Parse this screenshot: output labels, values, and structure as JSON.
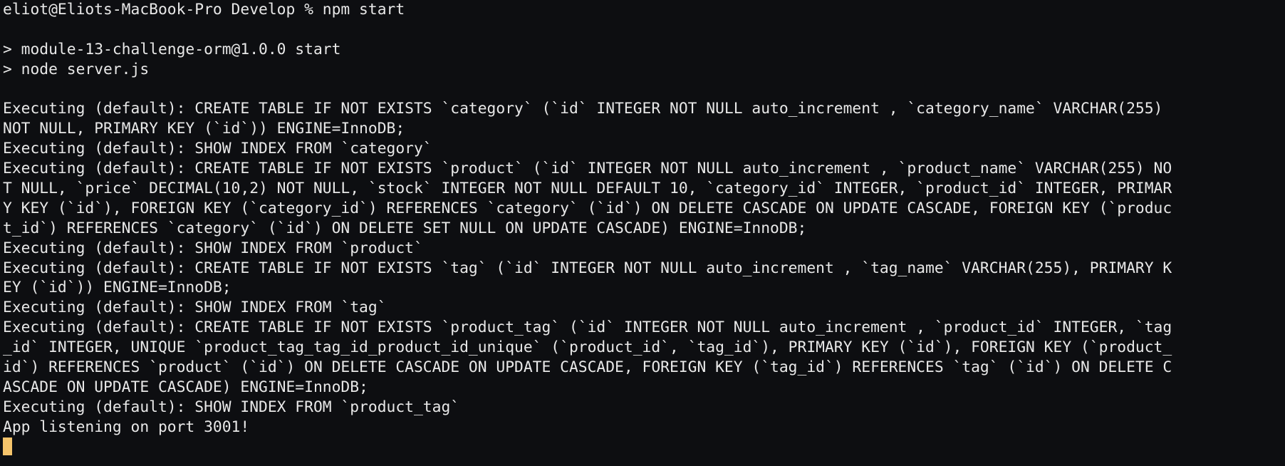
{
  "terminal": {
    "prompt_line": "eliot@Eliots-MacBook-Pro Develop % npm start",
    "lines": [
      "> module-13-challenge-orm@1.0.0 start",
      "> node server.js",
      "",
      "Executing (default): CREATE TABLE IF NOT EXISTS `category` (`id` INTEGER NOT NULL auto_increment , `category_name` VARCHAR(255)",
      "NOT NULL, PRIMARY KEY (`id`)) ENGINE=InnoDB;",
      "Executing (default): SHOW INDEX FROM `category`",
      "Executing (default): CREATE TABLE IF NOT EXISTS `product` (`id` INTEGER NOT NULL auto_increment , `product_name` VARCHAR(255) NO",
      "T NULL, `price` DECIMAL(10,2) NOT NULL, `stock` INTEGER NOT NULL DEFAULT 10, `category_id` INTEGER, `product_id` INTEGER, PRIMAR",
      "Y KEY (`id`), FOREIGN KEY (`category_id`) REFERENCES `category` (`id`) ON DELETE CASCADE ON UPDATE CASCADE, FOREIGN KEY (`produc",
      "t_id`) REFERENCES `category` (`id`) ON DELETE SET NULL ON UPDATE CASCADE) ENGINE=InnoDB;",
      "Executing (default): SHOW INDEX FROM `product`",
      "Executing (default): CREATE TABLE IF NOT EXISTS `tag` (`id` INTEGER NOT NULL auto_increment , `tag_name` VARCHAR(255), PRIMARY K",
      "EY (`id`)) ENGINE=InnoDB;",
      "Executing (default): SHOW INDEX FROM `tag`",
      "Executing (default): CREATE TABLE IF NOT EXISTS `product_tag` (`id` INTEGER NOT NULL auto_increment , `product_id` INTEGER, `tag",
      "_id` INTEGER, UNIQUE `product_tag_tag_id_product_id_unique` (`product_id`, `tag_id`), PRIMARY KEY (`id`), FOREIGN KEY (`product_",
      "id`) REFERENCES `product` (`id`) ON DELETE CASCADE ON UPDATE CASCADE, FOREIGN KEY (`tag_id`) REFERENCES `tag` (`id`) ON DELETE C",
      "ASCADE ON UPDATE CASCADE) ENGINE=InnoDB;",
      "Executing (default): SHOW INDEX FROM `product_tag`",
      "App listening on port 3001!"
    ],
    "colors": {
      "background": "#0d0e11",
      "foreground": "#e8e8e8",
      "cursor": "#f5c46b"
    }
  }
}
